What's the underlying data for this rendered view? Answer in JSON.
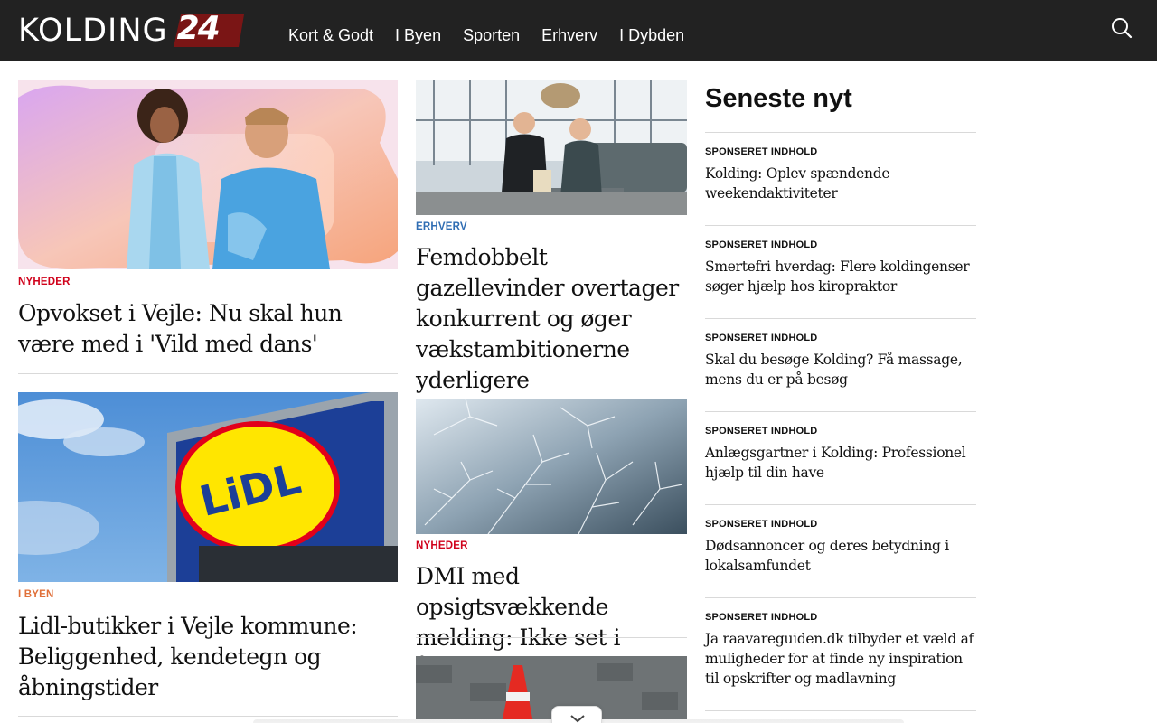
{
  "header": {
    "logo_text": "KOLDING",
    "logo_number": "24",
    "nav": [
      "Kort & Godt",
      "I Byen",
      "Sporten",
      "Erhverv",
      "I Dybden"
    ],
    "search_icon": "search-icon"
  },
  "articles": {
    "col1": [
      {
        "category": "NYHEDER",
        "headline": "Opvokset i Vejle: Nu skal hun være med i 'Vild med dans'",
        "image": "dancers-photo"
      },
      {
        "category": "I BYEN",
        "headline": "Lidl-butikker i Vejle kommune: Beliggenhed, kendetegn og åbningstider",
        "image": "lidl-sign-photo"
      }
    ],
    "col2": [
      {
        "category": "ERHVERV",
        "headline": "Femdobbelt gazellevinder overtager konkurrent og øger vækstambitionerne yderligere",
        "image": "business-men-photo"
      },
      {
        "category": "NYHEDER",
        "headline": "DMI med opsigtsvækkende melding: Ikke set i årevis",
        "image": "frost-photo"
      },
      {
        "image": "traffic-cone-photo"
      }
    ]
  },
  "latest": {
    "title": "Seneste nyt",
    "items": [
      {
        "label": "SPONSERET INDHOLD",
        "text": "Kolding: Oplev spændende weekendaktiviteter"
      },
      {
        "label": "SPONSERET INDHOLD",
        "text": "Smertefri hverdag: Flere koldingenser søger hjælp hos kiropraktor"
      },
      {
        "label": "SPONSERET INDHOLD",
        "text": "Skal du besøge Kolding? Få massage, mens du er på besøg"
      },
      {
        "label": "SPONSERET INDHOLD",
        "text": "Anlægsgartner i Kolding: Professionel hjælp til din have"
      },
      {
        "label": "SPONSERET INDHOLD",
        "text": "Dødsannoncer og deres betydning i lokalsamfundet"
      },
      {
        "label": "SPONSERET INDHOLD",
        "text": "Ja raavareguiden.dk tilbyder et væld af muligheder for at finde ny inspiration til opskrifter og madlavning"
      }
    ]
  },
  "scroll_icon": "chevron-down-icon",
  "colors": {
    "header_bg": "#222222",
    "logo_badge": "#7a1515",
    "category_red": "#d0021b",
    "category_blue": "#2f6db3",
    "category_orange": "#e0703a"
  }
}
